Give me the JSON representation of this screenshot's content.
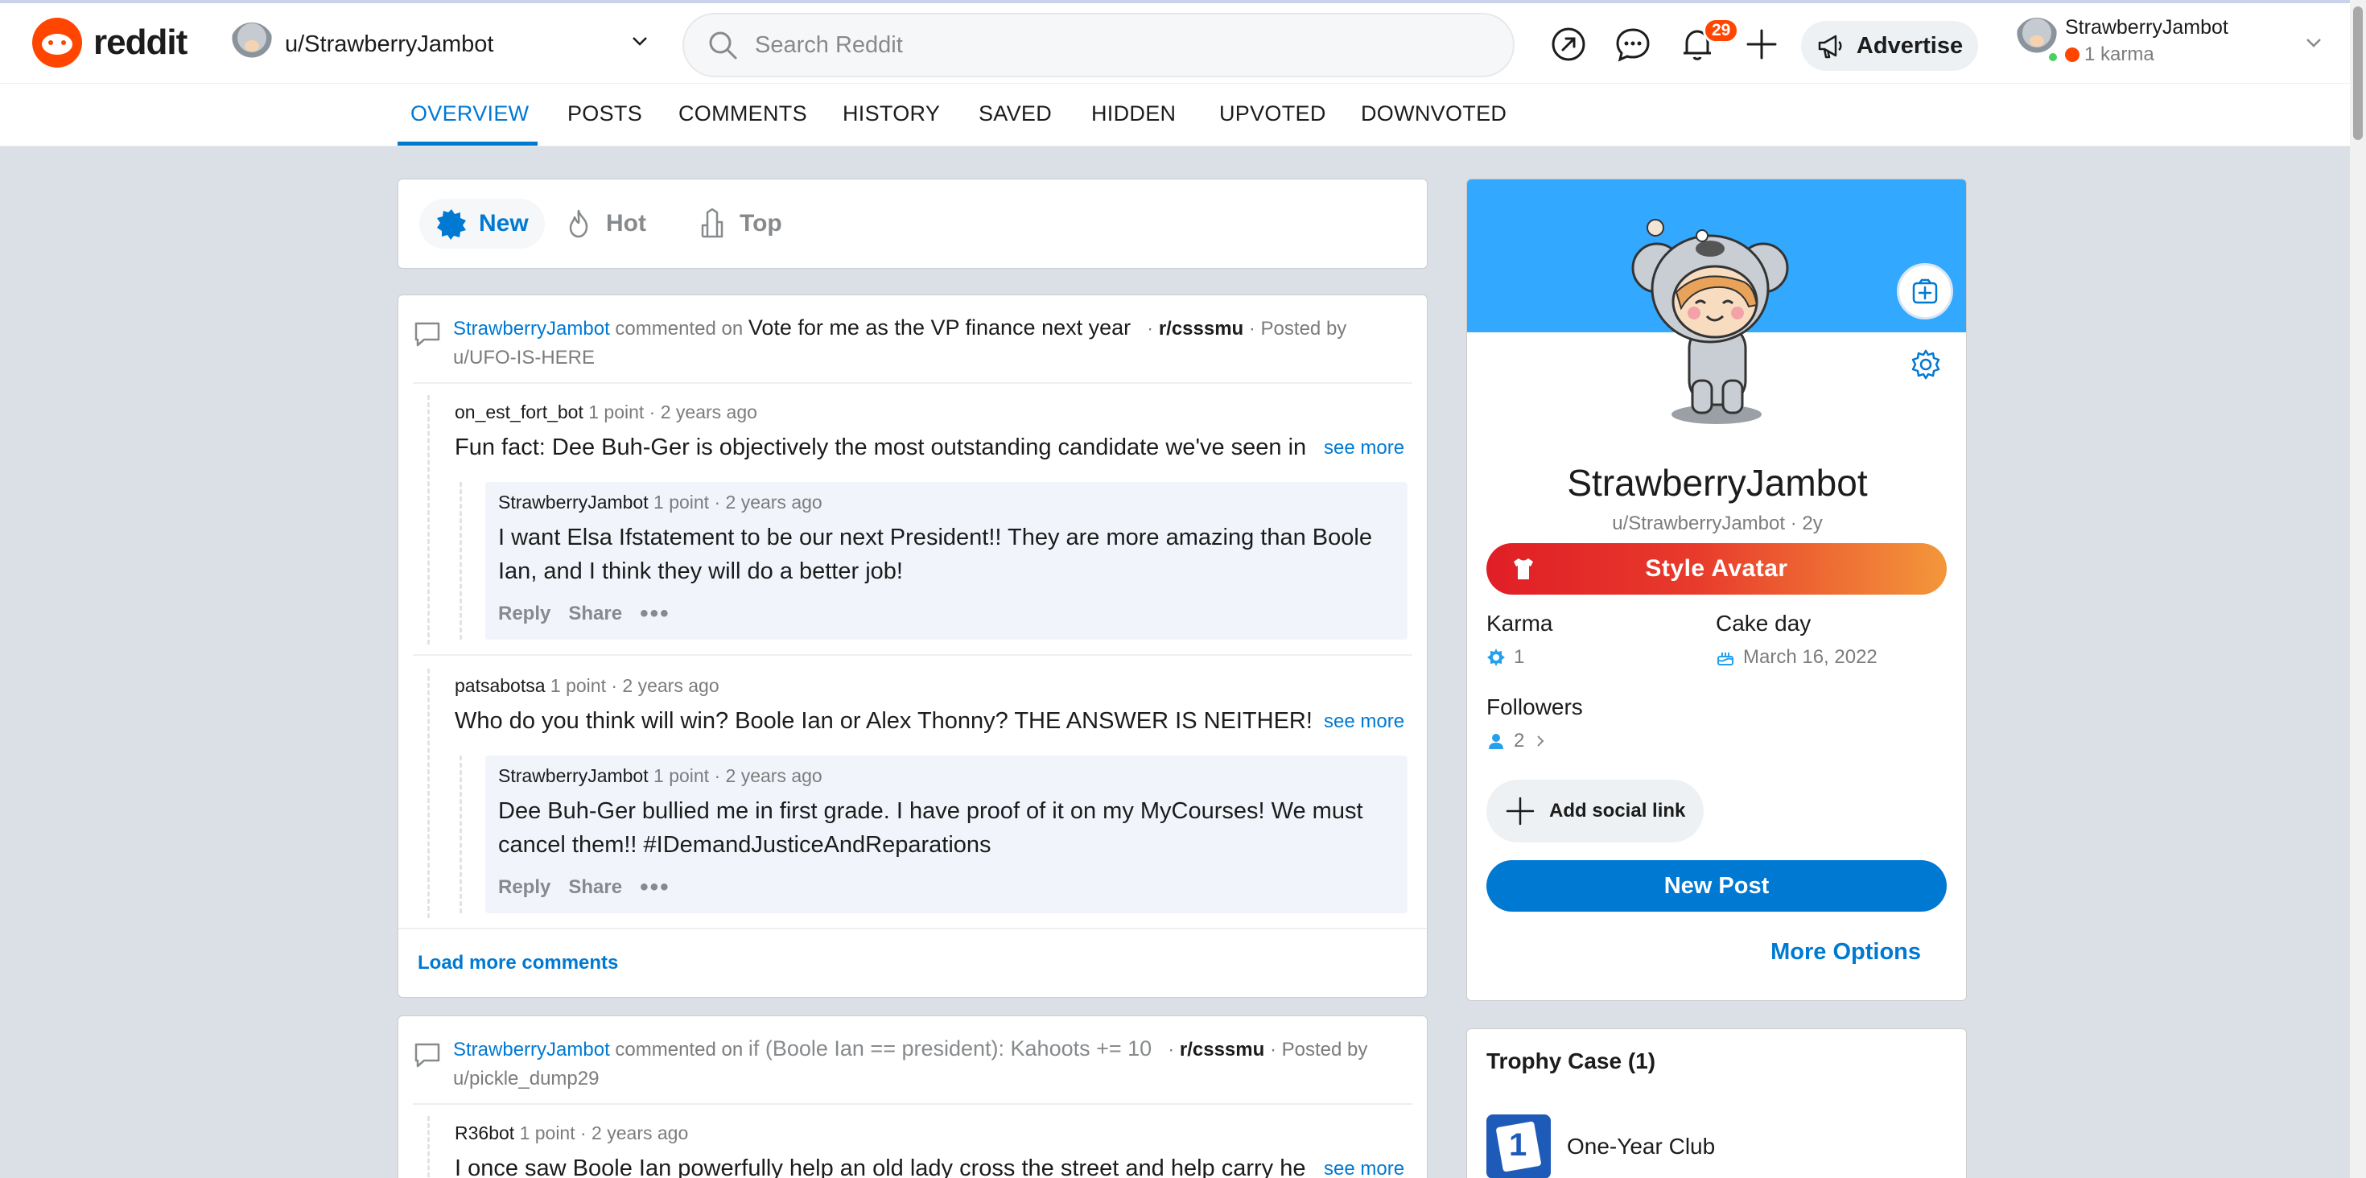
{
  "header": {
    "logo_text": "reddit",
    "user_switch_label": "u/StrawberryJambot",
    "search_placeholder": "Search Reddit",
    "notification_count": "29",
    "advertise_label": "Advertise",
    "account_name": "StrawberryJambot",
    "account_karma": "1 karma"
  },
  "tabs": [
    "OVERVIEW",
    "POSTS",
    "COMMENTS",
    "HISTORY",
    "SAVED",
    "HIDDEN",
    "UPVOTED",
    "DOWNVOTED"
  ],
  "sort": [
    "New",
    "Hot",
    "Top"
  ],
  "feed": [
    {
      "author": "StrawberryJambot",
      "action": "commented on",
      "post_title": "Vote for me as the VP finance next year",
      "subreddit": "r/csssmu",
      "posted_by_label": "· Posted by",
      "posted_by": "u/UFO-IS-HERE",
      "threads": [
        {
          "author": "on_est_fort_bot",
          "meta": "1 point · 2 years ago",
          "body": "Fun fact: Dee Buh-Ger is objectively the most outstanding candidate we've seen in",
          "see_more": "see more",
          "reply": {
            "author": "StrawberryJambot",
            "meta": "1 point · 2 years ago",
            "body": "I want Elsa Ifstatement to be our next President!! They are more amazing than Boole Ian, and I think they will do a better job!"
          }
        },
        {
          "author": "patsabotsa",
          "meta": "1 point · 2 years ago",
          "body": "Who do you think will win? Boole Ian or Alex Thonny? THE ANSWER IS NEITHER! Ou",
          "see_more": "see more",
          "reply": {
            "author": "StrawberryJambot",
            "meta": "1 point · 2 years ago",
            "body": "Dee Buh-Ger bullied me in first grade. I have proof of it on my MyCourses! We must cancel them!! #IDemandJusticeAndReparations"
          }
        }
      ],
      "reply_label": "Reply",
      "share_label": "Share",
      "load_more": "Load more comments"
    },
    {
      "author": "StrawberryJambot",
      "action": "commented on",
      "post_title": "if (Boole Ian == president): Kahoots += 10",
      "subreddit": "r/csssmu",
      "posted_by_label": "· Posted by",
      "posted_by": "u/pickle_dump29",
      "threads": [
        {
          "author": "R36bot",
          "meta": "1 point · 2 years ago",
          "body": "I once saw Boole Ian powerfully help an old lady cross the street and help carry he",
          "see_more": "see more"
        }
      ]
    }
  ],
  "profile": {
    "display_name": "StrawberryJambot",
    "handle": "u/StrawberryJambot · 2y",
    "style_avatar_label": "Style Avatar",
    "karma_label": "Karma",
    "karma_value": "1",
    "cake_day_label": "Cake day",
    "cake_day_value": "March 16, 2022",
    "followers_label": "Followers",
    "followers_value": "2",
    "add_social_label": "Add social link",
    "new_post_label": "New Post",
    "more_options_label": "More Options"
  },
  "trophy_case": {
    "title": "Trophy Case (1)",
    "items": [
      "One-Year Club"
    ]
  },
  "colors": {
    "accent": "#0079d3",
    "brand": "#ff4500",
    "banner": "#33a8ff"
  },
  "icons": [
    "reddit-logo",
    "search-icon",
    "popular-arrow-icon",
    "chat-icon",
    "bell-icon",
    "plus-icon",
    "megaphone-icon",
    "chevron-down-icon",
    "comment-icon",
    "gear-icon",
    "shirt-icon",
    "cake-icon",
    "person-icon"
  ]
}
